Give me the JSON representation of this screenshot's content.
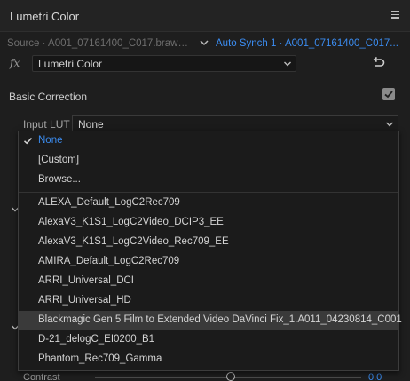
{
  "panel": {
    "title": "Lumetri Color"
  },
  "source": {
    "inactive": "Source · A001_07161400_C017.brawMul...",
    "active": "Auto Synch 1 · A001_07161400_C017..."
  },
  "fx": {
    "label": "fx",
    "effect": "Lumetri Color"
  },
  "basic_correction": {
    "label": "Basic Correction",
    "enabled": true
  },
  "input_lut": {
    "label": "Input LUT",
    "value": "None"
  },
  "background": {
    "contrast_label": "Contrast",
    "contrast_value": "0.0"
  },
  "dropdown": {
    "items": [
      {
        "label": "None",
        "selected": true
      },
      {
        "label": "[Custom]"
      },
      {
        "label": "Browse..."
      },
      {
        "label": "ALEXA_Default_LogC2Rec709"
      },
      {
        "label": "AlexaV3_K1S1_LogC2Video_DCIP3_EE"
      },
      {
        "label": "AlexaV3_K1S1_LogC2Video_Rec709_EE"
      },
      {
        "label": "AMIRA_Default_LogC2Rec709"
      },
      {
        "label": "ARRI_Universal_DCI"
      },
      {
        "label": "ARRI_Universal_HD"
      },
      {
        "label": "Blackmagic Gen 5 Film to Extended Video DaVinci Fix_1.A011_04230814_C001",
        "hovered": true
      },
      {
        "label": "D-21_delogC_EI0200_B1"
      },
      {
        "label": "Phantom_Rec709_Gamma"
      }
    ]
  },
  "colors": {
    "accent": "#3b8cf0",
    "panel_bg": "#1e1e1e",
    "hover_bg": "#3a3a3a"
  },
  "icons": {
    "menu": "hamburger-icon",
    "chevron": "chevron-down-icon",
    "reset": "reset-icon",
    "check": "checkmark-icon"
  }
}
